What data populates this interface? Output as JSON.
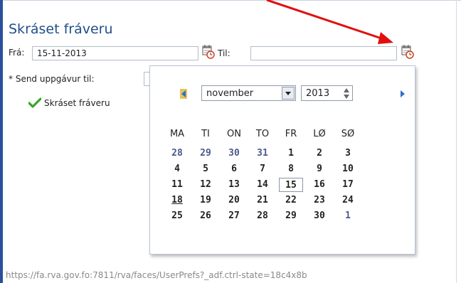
{
  "form": {
    "title": "Skráset fráveru",
    "from_label": "Frá:",
    "from_value": "15-11-2013",
    "to_label": "Til:",
    "to_value": "",
    "send_label": "Send uppgávur til:",
    "required_mark": "*",
    "status_text": "Skráset fráveru"
  },
  "status_bar": {
    "text": "https://fa.rva.gov.fo:7811/rva/faces/UserPrefs?_adf.ctrl-state=18c4x8b"
  },
  "calendar": {
    "month": "november",
    "year": "2013",
    "weekdays": [
      "MA",
      "TI",
      "ON",
      "TO",
      "FR",
      "LØ",
      "SØ"
    ],
    "weeks": [
      [
        "28",
        "29",
        "30",
        "31",
        "1",
        "2",
        "3"
      ],
      [
        "4",
        "5",
        "6",
        "7",
        "8",
        "9",
        "10"
      ],
      [
        "11",
        "12",
        "13",
        "14",
        "15",
        "16",
        "17"
      ],
      [
        "18",
        "19",
        "20",
        "21",
        "22",
        "23",
        "24"
      ],
      [
        "25",
        "26",
        "27",
        "28",
        "29",
        "30",
        "1"
      ]
    ],
    "selected_day": "15",
    "today_day": "18"
  },
  "colors": {
    "title": "#1f4f8a",
    "other_month_days": "#4d5a8c",
    "annotation_arrow": "#e01010",
    "check": "#3aa52a",
    "nav_arrows": "#2f6fc8"
  },
  "icons": {
    "calendar_from": "calendar-clock-icon",
    "calendar_to": "calendar-clock-icon",
    "check": "checkmark-icon",
    "prev": "triangle-left-icon",
    "next": "triangle-right-icon"
  }
}
